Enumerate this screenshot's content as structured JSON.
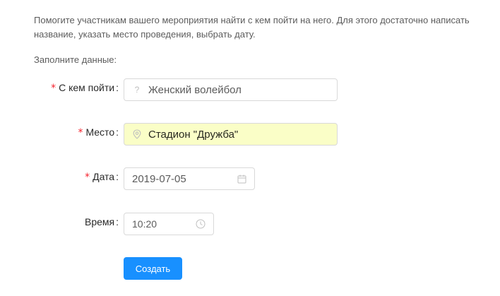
{
  "intro": {
    "text": "Помогите участникам вашего мероприятия найти с кем пойти на него. Для этого достаточно написать название, указать место проведения, выбрать дату."
  },
  "form": {
    "fill_label": "Заполните данные:",
    "required_mark": "*",
    "colon": ":",
    "fields": {
      "who": {
        "label": "С кем пойти",
        "prefix_icon": "question-icon",
        "value": "Женский волейбол",
        "required": true
      },
      "place": {
        "label": "Место",
        "prefix_icon": "map-pin-icon",
        "value": "Стадион \"Дружба\"",
        "required": true
      },
      "date": {
        "label": "Дата",
        "value": "2019-07-05",
        "suffix_icon": "calendar-icon",
        "required": true
      },
      "time": {
        "label": "Время",
        "value": "10:20",
        "suffix_icon": "clock-icon",
        "required": false
      }
    },
    "submit_label": "Создать"
  },
  "colors": {
    "primary": "#1890ff",
    "required": "#f5222d",
    "autofill_bg": "#fafec7",
    "border": "#d9d9d9"
  }
}
